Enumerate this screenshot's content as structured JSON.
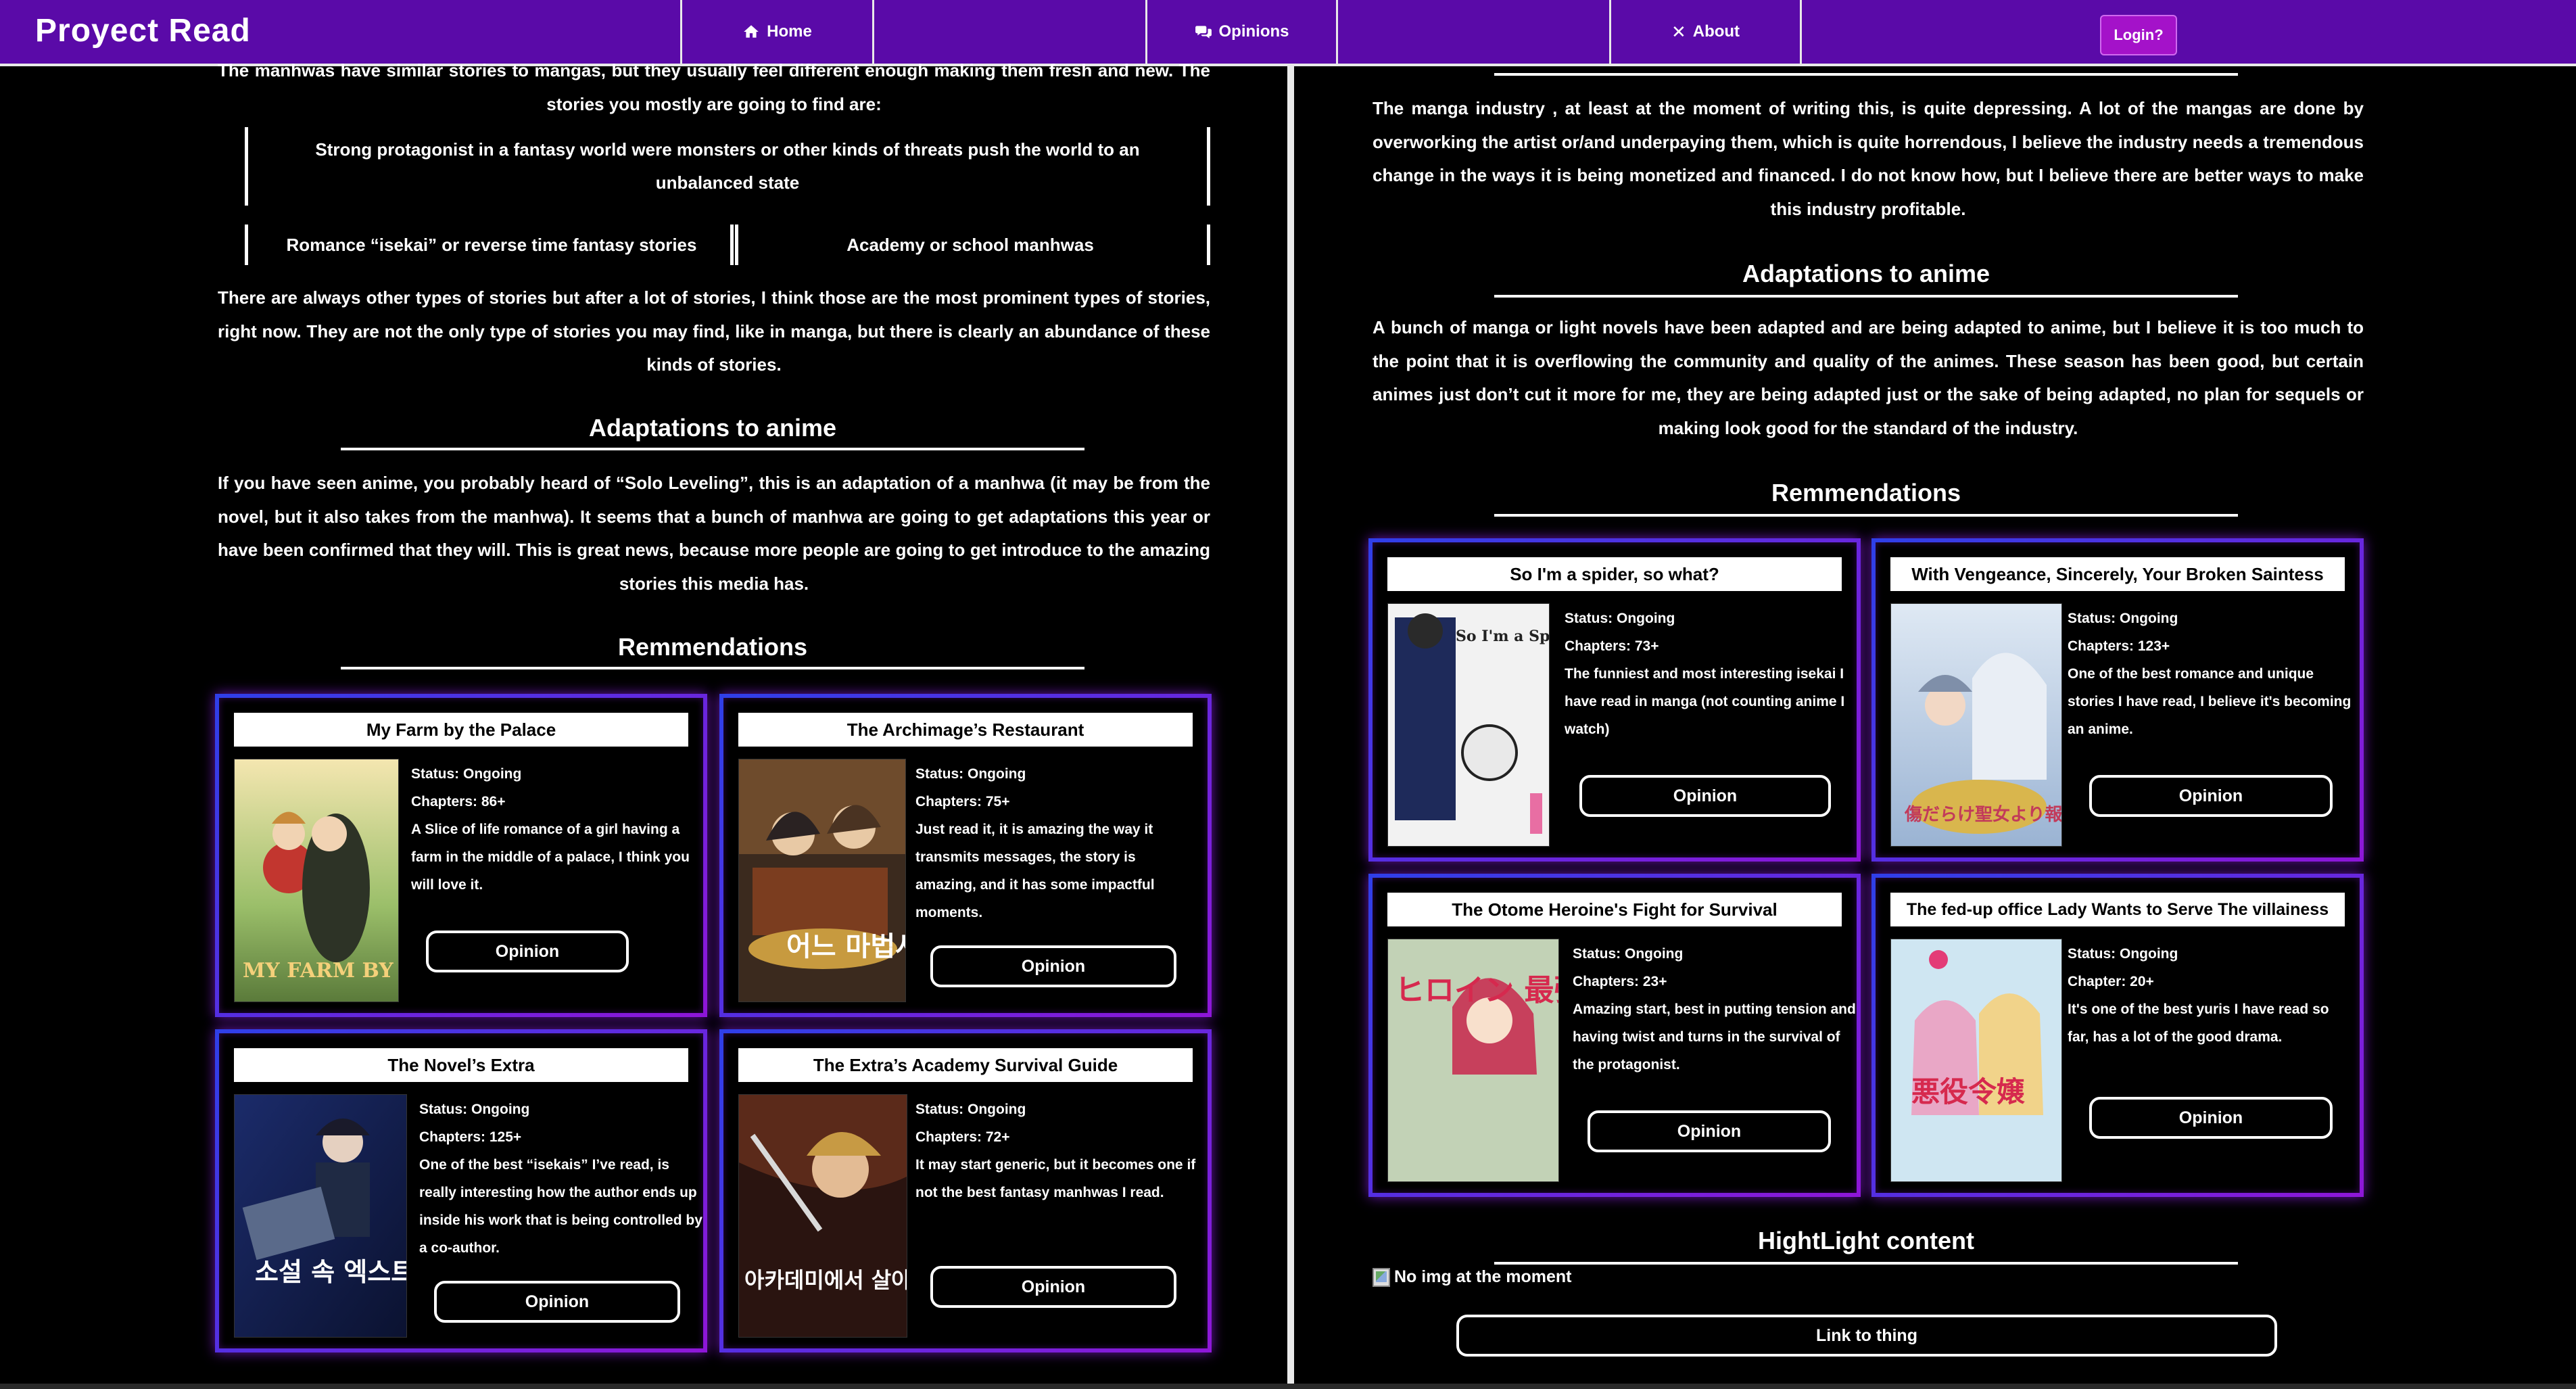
{
  "nav": {
    "brand": "Proyect Read",
    "home": "Home",
    "opinions": "Opinions",
    "about": "About",
    "login": "Login?"
  },
  "left": {
    "intro_cut": "The manhwas have similar stories to mangas, but they usually feel different enough making them fresh and new. The stories you mostly are going to find are:",
    "story1": "Strong protagonist in a fantasy world were monsters or other kinds of threats push the world to an unbalanced state",
    "story2": "Romance “isekai” or reverse time fantasy stories",
    "story3": "Academy or school manhwas",
    "para2": "There are always other types of stories but after a lot of stories, I think those are the most prominent types of stories, right now. They are not the only type of stories you may find, like in manga, but there is clearly an abundance of these kinds of stories.",
    "adapt_title": "Adaptations to anime",
    "adapt_text": "If you have seen anime, you probably heard of “Solo Leveling”, this is an adaptation of a manhwa (it may be from the novel, but it also takes from the manhwa). It seems that a bunch of manhwa are going to get adaptations this year or have been confirmed that they will. This is great news, because more people are going to get introduce to the amazing stories this media has.",
    "rec_title": "Remmendations",
    "cards": [
      {
        "title": "My Farm by the Palace",
        "status": "Status: Ongoing",
        "chapters": "Chapters: 86+",
        "desc": "A Slice of life romance of a girl having a farm in the middle of a palace, I think you will love it.",
        "cover_text": "MY FARM BY THE PALACE",
        "button": "Opinion"
      },
      {
        "title": "The Archimage’s Restaurant",
        "status": "Status: Ongoing",
        "chapters": "Chapters: 75+",
        "desc": "Just read it, it is amazing the way it transmits messages, the story is amazing, and it has some impactful moments.",
        "cover_text": "어느 마법사의 식당",
        "button": "Opinion"
      },
      {
        "title": "The Novel’s Extra",
        "status": "Status: Ongoing",
        "chapters": "Chapters: 125+",
        "desc": "One of the best “isekais” I’ve read, is really interesting how the author ends up inside his work that is being controlled by a co-author.",
        "cover_text": "소설 속 엑스트라",
        "button": "Opinion"
      },
      {
        "title": "The Extra’s Academy Survival Guide",
        "status": "Status: Ongoing",
        "chapters": "Chapters: 72+",
        "desc": "It may start generic, but it becomes one if not the best fantasy manhwas I read.",
        "cover_text": "아카데미에서 살아남기",
        "button": "Opinion"
      }
    ]
  },
  "right": {
    "intro": "The manga industry , at least at the moment of writing this, is quite depressing. A lot of the mangas are done by overworking the artist or/and underpaying them, which is quite horrendous, I believe the industry needs a tremendous change in the ways it is being monetized and financed. I do not know how, but I believe there are better ways to make this industry profitable.",
    "adapt_title": "Adaptations to anime",
    "adapt_text": "A bunch of manga or light novels have been adapted and are being adapted to anime, but I believe it is too much to the point that it is overflowing the community and quality of the animes. These season has been good, but certain animes just don’t cut it more for me, they are being adapted just or the sake of being adapted, no plan for sequels or making look good for the standard of the industry.",
    "rec_title": "Remmendations",
    "cards": [
      {
        "title": "So I'm a spider, so what?",
        "status": "Status: Ongoing",
        "chapters": "Chapters: 73+",
        "desc": "The funniest and most interesting isekai I have read in manga (not counting anime I watch)",
        "cover_text": "So I'm a Spider, So What?",
        "button": "Opinion"
      },
      {
        "title": "With Vengeance, Sincerely, Your Broken Saintess",
        "status": "Status: Ongoing",
        "chapters": "Chapters: 123+",
        "desc": "One of the best romance and unique stories I have read, I believe it's becoming an anime.",
        "cover_text": "傷だらけ聖女より報復をこめて",
        "button": "Opinion"
      },
      {
        "title": "The Otome Heroine's Fight for Survival",
        "status": "Status: Ongoing",
        "chapters": "Chapters: 23+",
        "desc": "Amazing start, best in putting tension and having twist and turns in the survival of the protagonist.",
        "cover_text": "ヒロイン 最強サバイバル",
        "button": "Opinion"
      },
      {
        "title": "The fed-up office Lady Wants to Serve The villainess",
        "status": "Status: Ongoing",
        "chapters": "Chapter: 20+",
        "desc": "It's one of the best yuris I have read so far, has a lot of the good drama.",
        "cover_text": "悪役令嬢",
        "button": "Opinion"
      }
    ],
    "highlight_title": "HightLight content",
    "noimg_alt": "No img at the moment",
    "link_button": "Link to thing"
  }
}
